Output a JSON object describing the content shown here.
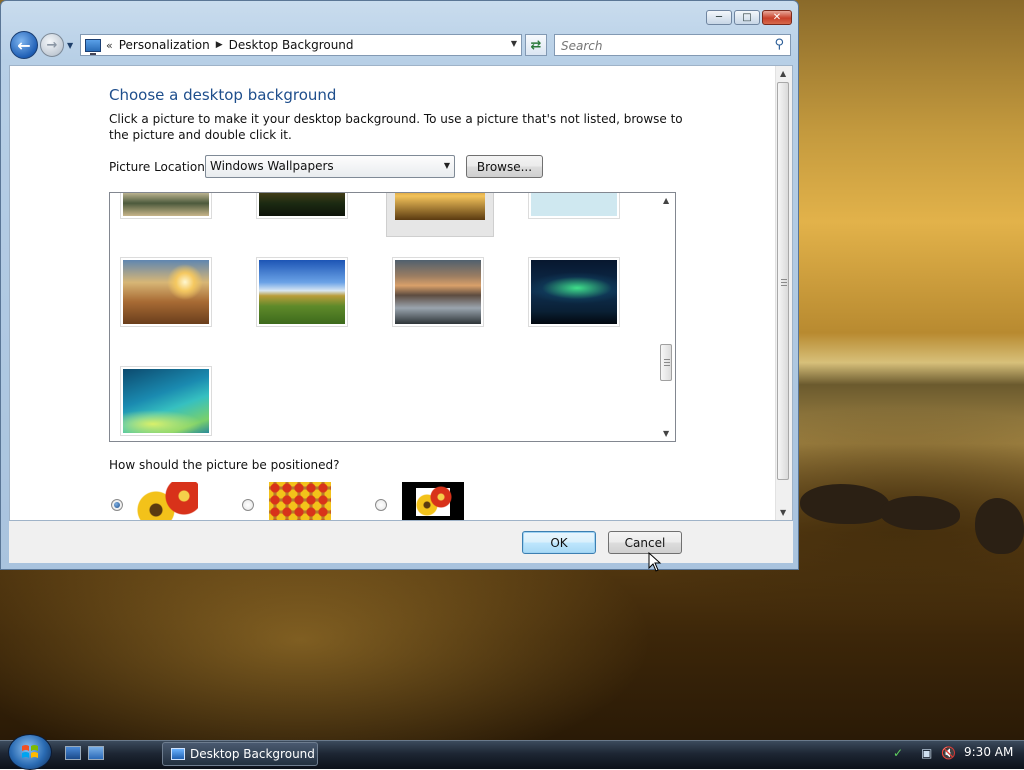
{
  "window": {
    "breadcrumb": [
      "Personalization",
      "Desktop Background"
    ],
    "search_placeholder": "Search",
    "caption_buttons": [
      "minimize",
      "maximize",
      "close"
    ]
  },
  "content": {
    "title": "Choose a desktop background",
    "description": "Click a picture to make it your desktop background. To use a picture that's not listed, browse to the picture and double click it.",
    "picture_location_label": "Picture Location",
    "picture_location_value": "Windows Wallpapers",
    "browse_label": "Browse...",
    "position_question": "How should the picture be positioned?",
    "position_options": [
      "fit-to-screen",
      "tile",
      "center"
    ],
    "position_selected": "fit-to-screen"
  },
  "gallery": {
    "wallpapers": [
      {
        "name": "lake-rocks",
        "row": 0,
        "col": 0
      },
      {
        "name": "dark-forest-sunset",
        "row": 0,
        "col": 1
      },
      {
        "name": "golden-lake",
        "row": 0,
        "col": 2,
        "selected": true
      },
      {
        "name": "green-leaf",
        "row": 0,
        "col": 3
      },
      {
        "name": "sunset-grass",
        "row": 1,
        "col": 0
      },
      {
        "name": "green-hills-blue-sky",
        "row": 1,
        "col": 1
      },
      {
        "name": "mountain-reflection",
        "row": 1,
        "col": 2
      },
      {
        "name": "aurora",
        "row": 1,
        "col": 3
      },
      {
        "name": "vista-aurora-teal",
        "row": 2,
        "col": 0
      }
    ]
  },
  "footer": {
    "ok_label": "OK",
    "cancel_label": "Cancel"
  },
  "taskbar": {
    "task_label": "Desktop Background",
    "clock": "9:30 AM"
  },
  "colors": {
    "title_blue": "#1e4e8c",
    "taskbar_dark": "#1d2633"
  }
}
